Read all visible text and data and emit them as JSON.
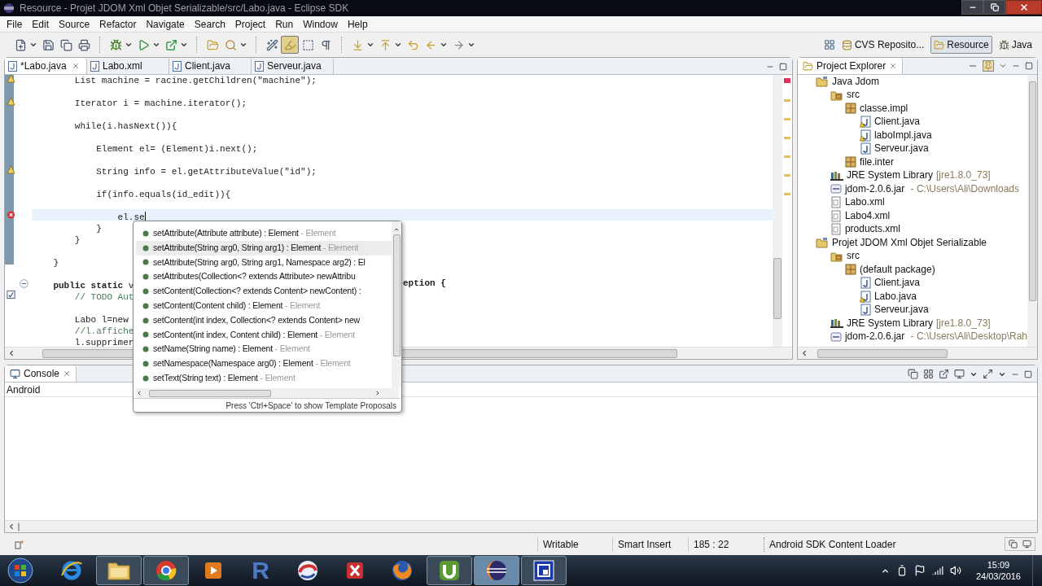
{
  "window": {
    "title": "Resource - Projet JDOM Xml Objet Serializable/src/Labo.java - Eclipse SDK"
  },
  "menu": [
    "File",
    "Edit",
    "Source",
    "Refactor",
    "Navigate",
    "Search",
    "Project",
    "Run",
    "Window",
    "Help"
  ],
  "toolbar": [
    {
      "kind": "new",
      "menu": true,
      "pressed": false
    },
    {
      "kind": "save",
      "menu": false,
      "pressed": false
    },
    {
      "kind": "save-all",
      "menu": false,
      "pressed": false
    },
    {
      "kind": "print",
      "menu": false,
      "pressed": false
    },
    {
      "kind": "separator"
    },
    {
      "kind": "debug",
      "menu": true,
      "pressed": false
    },
    {
      "kind": "run",
      "menu": true,
      "pressed": false
    },
    {
      "kind": "external",
      "menu": true,
      "pressed": false
    },
    {
      "kind": "separator"
    },
    {
      "kind": "open",
      "menu": false,
      "pressed": false
    },
    {
      "kind": "search",
      "menu": true,
      "pressed": false
    },
    {
      "kind": "separator"
    },
    {
      "kind": "toggle",
      "menu": false,
      "pressed": false
    },
    {
      "kind": "highlight",
      "menu": false,
      "pressed": true
    },
    {
      "kind": "block",
      "menu": false,
      "pressed": false
    },
    {
      "kind": "whitespace",
      "menu": false,
      "pressed": false
    },
    {
      "kind": "separator"
    },
    {
      "kind": "next",
      "menu": true,
      "pressed": false
    },
    {
      "kind": "prev",
      "menu": true,
      "pressed": false
    },
    {
      "kind": "last-edit",
      "menu": false,
      "pressed": false
    },
    {
      "kind": "back",
      "menu": true,
      "pressed": false
    },
    {
      "kind": "forward",
      "menu": true,
      "pressed": false
    }
  ],
  "perspectives": [
    {
      "label": "CVS Reposito...",
      "selected": false
    },
    {
      "label": "Resource",
      "selected": true
    },
    {
      "label": "Java",
      "selected": false
    }
  ],
  "editor": {
    "tabs": [
      {
        "label": "*Labo.java",
        "selected": true
      },
      {
        "label": "Labo.xml",
        "selected": false
      },
      {
        "label": "Client.java",
        "selected": false
      },
      {
        "label": "Serveur.java",
        "selected": false
      }
    ],
    "lines": [
      {
        "text": "        List machine = racine.getChildren(\"machine\");",
        "kind": "warning",
        "comment": false,
        "gap": true,
        "current": false
      },
      {
        "text": "        Iterator i = machine.iterator();",
        "kind": "warning",
        "comment": false,
        "gap": true,
        "current": false
      },
      {
        "text": "        while(i.hasNext()){",
        "kind": "plain",
        "comment": false,
        "gap": true,
        "current": false
      },
      {
        "text": "            Element el= (Element)i.next();",
        "kind": "plain",
        "comment": false,
        "gap": true,
        "current": false
      },
      {
        "text": "            String info = el.getAttributeValue(\"id\");",
        "kind": "warning",
        "comment": false,
        "gap": true,
        "current": false
      },
      {
        "text": "            if(info.equals(id_edit)){",
        "kind": "plain",
        "comment": false,
        "gap": true,
        "current": false
      },
      {
        "text": "                el.se",
        "kind": "error",
        "comment": false,
        "gap": false,
        "current": true
      },
      {
        "text": "            }",
        "kind": "plain",
        "comment": false,
        "gap": false,
        "current": false
      },
      {
        "text": "        }",
        "kind": "plain",
        "comment": false,
        "gap": true,
        "current": false
      },
      {
        "text": "    }",
        "kind": "plain",
        "comment": false,
        "gap": true,
        "current": false
      },
      {
        "text": "    **public static** v",
        "tail": "eption {",
        "kind": "fold",
        "comment": false,
        "gap": false,
        "current": false
      },
      {
        "text": "        // TODO Aut",
        "kind": "task",
        "comment": true,
        "gap": true,
        "current": false
      },
      {
        "text": "        Labo l=new",
        "kind": "plain",
        "comment": false,
        "gap": false,
        "current": false
      },
      {
        "text": "        //l.affiche",
        "kind": "plain",
        "comment": true,
        "gap": false,
        "current": false
      },
      {
        "text": "        l.supprimer",
        "kind": "plain",
        "comment": false,
        "gap": false,
        "current": false
      }
    ],
    "completion": {
      "items": [
        {
          "signature": "setAttribute(Attribute attribute) : Element",
          "type": " - Element",
          "selected": false
        },
        {
          "signature": "setAttribute(String arg0, String arg1) : Element",
          "type": " - Element",
          "selected": true
        },
        {
          "signature": "setAttribute(String arg0, String arg1, Namespace arg2) : El",
          "selected": false
        },
        {
          "signature": "setAttributes(Collection<? extends Attribute> newAttribu",
          "selected": false
        },
        {
          "signature": "setContent(Collection<? extends Content> newContent) :",
          "selected": false
        },
        {
          "signature": "setContent(Content child) : Element",
          "type": " - Element",
          "selected": false
        },
        {
          "signature": "setContent(int index, Collection<? extends Content> new",
          "selected": false
        },
        {
          "signature": "setContent(int index, Content child) : Element",
          "type": " - Element",
          "selected": false
        },
        {
          "signature": "setName(String name) : Element",
          "type": " - Element",
          "selected": false
        },
        {
          "signature": "setNamespace(Namespace arg0) : Element",
          "type": " - Element",
          "selected": false
        },
        {
          "signature": "setText(String text) : Element",
          "type": " - Element",
          "selected": false
        }
      ],
      "hint": "Press 'Ctrl+Space' to show Template Proposals"
    }
  },
  "explorer": {
    "title": "Project Explorer",
    "tree": [
      {
        "label": "Java Jdom",
        "kind": "project",
        "children": [
          {
            "label": "src",
            "kind": "source",
            "children": [
              {
                "label": "classe.impl",
                "kind": "package",
                "children": [
                  {
                    "label": "Client.java",
                    "kind": "java-warning"
                  },
                  {
                    "label": "laboImpl.java",
                    "kind": "java-warning"
                  },
                  {
                    "label": "Serveur.java",
                    "kind": "java"
                  }
                ]
              },
              {
                "label": "file.inter",
                "kind": "package"
              }
            ]
          },
          {
            "label": "JRE System Library",
            "detail": "[jre1.8.0_73]",
            "kind": "library"
          },
          {
            "label": "jdom-2.0.6.jar",
            "detail": " - C:\\Users\\Ali\\Downloads",
            "kind": "jar"
          },
          {
            "label": "Labo.xml",
            "kind": "xml"
          },
          {
            "label": "Labo4.xml",
            "kind": "xml"
          },
          {
            "label": "products.xml",
            "kind": "xml"
          }
        ]
      },
      {
        "label": "Projet JDOM Xml Objet Serializable",
        "kind": "project",
        "children": [
          {
            "label": "src",
            "kind": "source",
            "children": [
              {
                "label": "(default package)",
                "kind": "package",
                "children": [
                  {
                    "label": "Client.java",
                    "kind": "java"
                  },
                  {
                    "label": "Labo.java",
                    "kind": "java-warning"
                  },
                  {
                    "label": "Serveur.java",
                    "kind": "java"
                  }
                ]
              }
            ]
          },
          {
            "label": "JRE System Library",
            "detail": "[jre1.8.0_73]",
            "kind": "library"
          },
          {
            "label": "jdom-2.0.6.jar",
            "detail": " - C:\\Users\\Ali\\Desktop\\Rah",
            "kind": "jar"
          }
        ]
      }
    ]
  },
  "console": {
    "title": "Console",
    "label": "Android"
  },
  "status_bar": {
    "mode": "Writable",
    "insert": "Smart Insert",
    "position": "185 : 22",
    "task": "Android SDK Content Loader"
  },
  "taskbar": {
    "apps": [
      {
        "kind": "ie",
        "running": false,
        "active": false
      },
      {
        "kind": "folder",
        "running": true,
        "active": false
      },
      {
        "kind": "chrome",
        "running": true,
        "active": false
      },
      {
        "kind": "media",
        "running": false,
        "active": false
      },
      {
        "kind": "letter",
        "label": "R",
        "running": false,
        "active": false
      },
      {
        "kind": "swirl",
        "running": false,
        "active": false
      },
      {
        "kind": "cross",
        "running": false,
        "active": false
      },
      {
        "kind": "firefox",
        "running": false,
        "active": false
      },
      {
        "kind": "torrent",
        "running": true,
        "active": false
      },
      {
        "kind": "eclipse",
        "running": true,
        "active": true
      },
      {
        "kind": "window",
        "running": true,
        "active": false
      }
    ],
    "time": "15:09",
    "date": "24/03/2016"
  }
}
